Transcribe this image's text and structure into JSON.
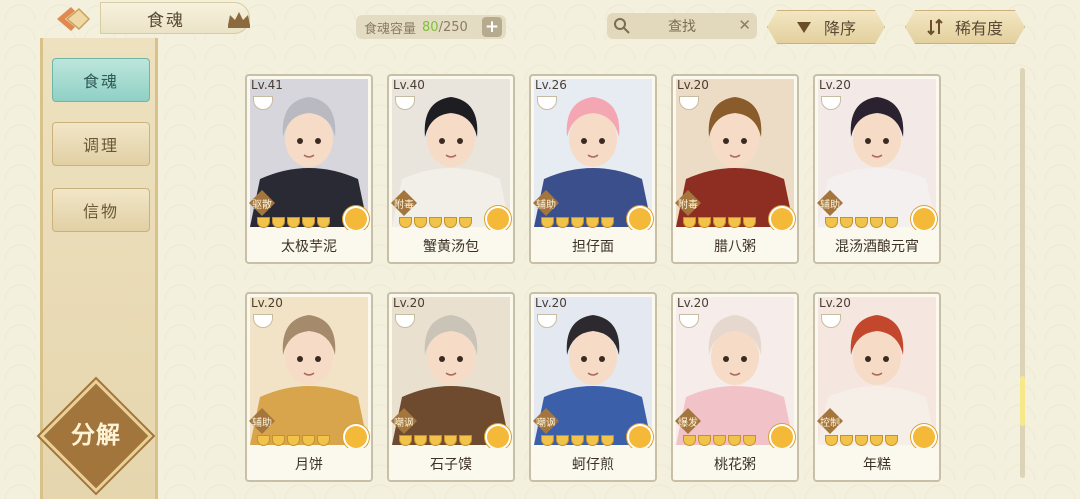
{
  "header": {
    "title": "食魂",
    "capacity_label": "食魂容量",
    "capacity_current": "80",
    "capacity_max": "/250",
    "plus_label": "+",
    "search_label": "查找",
    "clear_label": "✕",
    "sort_desc_label": "降序",
    "sort_rarity_label": "稀有度"
  },
  "sidebar": {
    "tabs": [
      {
        "label": "食魂",
        "active": true
      },
      {
        "label": "调理",
        "active": false
      },
      {
        "label": "信物",
        "active": false
      }
    ],
    "decompose_label": "分解"
  },
  "cards": [
    {
      "level": "Lv.41",
      "role": "驱散",
      "name": "太极芋泥",
      "stars": 5,
      "hair": "#b9b9c2",
      "coat": "#2a2a35",
      "bg": "#d6d6dc"
    },
    {
      "level": "Lv.40",
      "role": "附毒",
      "name": "蟹黄汤包",
      "stars": 5,
      "hair": "#1d1d22",
      "coat": "#f2efe8",
      "bg": "#e9e4dc"
    },
    {
      "level": "Lv.26",
      "role": "辅助",
      "name": "担仔面",
      "stars": 5,
      "hair": "#f4a7b2",
      "coat": "#3b4f8c",
      "bg": "#e7ebf2"
    },
    {
      "level": "Lv.20",
      "role": "附毒",
      "name": "腊八粥",
      "stars": 5,
      "hair": "#8a5b2b",
      "coat": "#8e2d22",
      "bg": "#ecdcc6"
    },
    {
      "level": "Lv.20",
      "role": "辅助",
      "name": "混汤酒酿元宵",
      "stars": 5,
      "hair": "#2b2230",
      "coat": "#f4f0f0",
      "bg": "#f3eae8"
    },
    {
      "level": "Lv.20",
      "role": "辅助",
      "name": "月饼",
      "stars": 5,
      "hair": "#a58a6c",
      "coat": "#d8a44c",
      "bg": "#f2e3c6"
    },
    {
      "level": "Lv.20",
      "role": "嘲讽",
      "name": "石子馍",
      "stars": 5,
      "hair": "#c9c3b8",
      "coat": "#6e4a2e",
      "bg": "#eae0d0"
    },
    {
      "level": "Lv.20",
      "role": "嘲讽",
      "name": "蚵仔煎",
      "stars": 5,
      "hair": "#2c2a2e",
      "coat": "#3b5fa8",
      "bg": "#e3e8f1"
    },
    {
      "level": "Lv.20",
      "role": "爆发",
      "name": "桃花粥",
      "stars": 5,
      "hair": "#e7d8cf",
      "coat": "#f1c3c9",
      "bg": "#f6ece9"
    },
    {
      "level": "Lv.20",
      "role": "控制",
      "name": "年糕",
      "stars": 5,
      "hair": "#c2472c",
      "coat": "#f6efe8",
      "bg": "#f5e6df"
    }
  ]
}
